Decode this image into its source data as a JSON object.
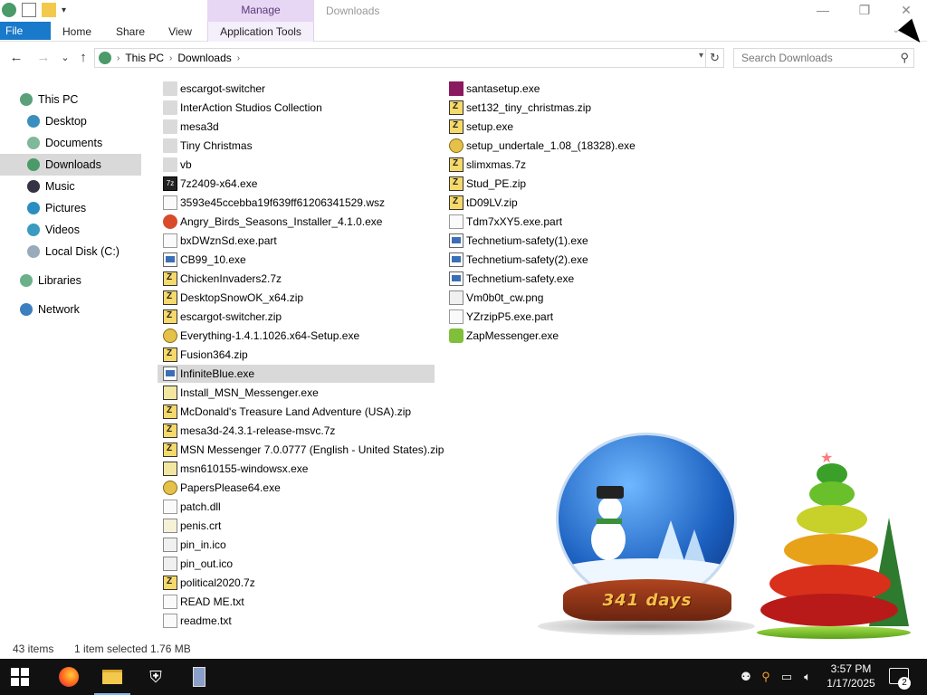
{
  "window": {
    "title": "Downloads",
    "context_tab": "Manage",
    "controls": {
      "minimize": "—",
      "maximize": "❐",
      "close": "✕"
    }
  },
  "ribbon": {
    "tabs": [
      "File",
      "Home",
      "Share",
      "View",
      "Application Tools"
    ],
    "file_color": "#1979ca",
    "manage_color": "#e7d6f4"
  },
  "nav": {
    "back": "←",
    "forward": "→",
    "recent": "⌄",
    "up": "↑",
    "breadcrumb": [
      "This PC",
      "Downloads"
    ],
    "refresh": "↻",
    "search_placeholder": "Search Downloads"
  },
  "sidebar": {
    "items": [
      {
        "label": "This PC",
        "icon": "pc-icon"
      },
      {
        "label": "Desktop",
        "icon": "desktop-icon"
      },
      {
        "label": "Documents",
        "icon": "documents-icon"
      },
      {
        "label": "Downloads",
        "icon": "downloads-icon",
        "selected": true
      },
      {
        "label": "Music",
        "icon": "music-icon"
      },
      {
        "label": "Pictures",
        "icon": "pictures-icon"
      },
      {
        "label": "Videos",
        "icon": "videos-icon"
      },
      {
        "label": "Local Disk (C:)",
        "icon": "disk-icon"
      },
      {
        "label": "Libraries",
        "icon": "libraries-icon"
      },
      {
        "label": "Network",
        "icon": "network-icon"
      }
    ]
  },
  "files": {
    "col1": [
      {
        "name": "escargot-switcher",
        "type": "folder"
      },
      {
        "name": "InterAction Studios Collection",
        "type": "folder"
      },
      {
        "name": "mesa3d",
        "type": "folder"
      },
      {
        "name": "Tiny Christmas",
        "type": "folder"
      },
      {
        "name": "vb",
        "type": "folder"
      },
      {
        "name": "7z2409-x64.exe",
        "type": "sz"
      },
      {
        "name": "3593e45ccebba19f639ff61206341529.wsz",
        "type": "generic"
      },
      {
        "name": "Angry_Birds_Seasons_Installer_4.1.0.exe",
        "type": "bird"
      },
      {
        "name": "bxDWznSd.exe.part",
        "type": "generic"
      },
      {
        "name": "CB99_10.exe",
        "type": "exe"
      },
      {
        "name": "ChickenInvaders2.7z",
        "type": "zip"
      },
      {
        "name": "DesktopSnowOK_x64.zip",
        "type": "zip"
      },
      {
        "name": "escargot-switcher.zip",
        "type": "zip"
      },
      {
        "name": "Everything-1.4.1.1026.x64-Setup.exe",
        "type": "disc"
      },
      {
        "name": "Fusion364.zip",
        "type": "zip"
      },
      {
        "name": "InfiniteBlue.exe",
        "type": "exe",
        "selected": true
      },
      {
        "name": "Install_MSN_Messenger.exe",
        "type": "msn"
      },
      {
        "name": "McDonald's Treasure Land Adventure (USA).zip",
        "type": "zip"
      },
      {
        "name": "mesa3d-24.3.1-release-msvc.7z",
        "type": "zip"
      },
      {
        "name": "MSN Messenger 7.0.0777 (English - United States).zip",
        "type": "zip"
      },
      {
        "name": "msn610155-windowsx.exe",
        "type": "msn"
      },
      {
        "name": "PapersPlease64.exe",
        "type": "disc"
      },
      {
        "name": "patch.dll",
        "type": "generic"
      },
      {
        "name": "penis.crt",
        "type": "cert"
      },
      {
        "name": "pin_in.ico",
        "type": "img"
      },
      {
        "name": "pin_out.ico",
        "type": "img"
      },
      {
        "name": "political2020.7z",
        "type": "zip"
      },
      {
        "name": "READ ME.txt",
        "type": "generic"
      },
      {
        "name": "readme.txt",
        "type": "generic"
      }
    ],
    "col2": [
      {
        "name": "santasetup.exe",
        "type": "santa"
      },
      {
        "name": "set132_tiny_christmas.zip",
        "type": "zip"
      },
      {
        "name": "setup.exe",
        "type": "zip"
      },
      {
        "name": "setup_undertale_1.08_(18328).exe",
        "type": "disc"
      },
      {
        "name": "slimxmas.7z",
        "type": "zip"
      },
      {
        "name": "Stud_PE.zip",
        "type": "zip"
      },
      {
        "name": "tD09LV.zip",
        "type": "zip"
      },
      {
        "name": "Tdm7xXY5.exe.part",
        "type": "generic"
      },
      {
        "name": "Technetium-safety(1).exe",
        "type": "exe"
      },
      {
        "name": "Technetium-safety(2).exe",
        "type": "exe"
      },
      {
        "name": "Technetium-safety.exe",
        "type": "exe"
      },
      {
        "name": "Vm0b0t_cw.png",
        "type": "img"
      },
      {
        "name": "YZrzipP5.exe.part",
        "type": "generic"
      },
      {
        "name": "ZapMessenger.exe",
        "type": "zap"
      }
    ]
  },
  "status": {
    "count": "43 items",
    "selection": "1 item selected  1.76 MB"
  },
  "widget": {
    "days": "341 days"
  },
  "taskbar": {
    "apps": [
      "firefox-icon",
      "file-explorer-icon",
      "security-icon",
      "installer-icon"
    ],
    "time": "3:57 PM",
    "date": "1/17/2025",
    "notifications": "2"
  }
}
